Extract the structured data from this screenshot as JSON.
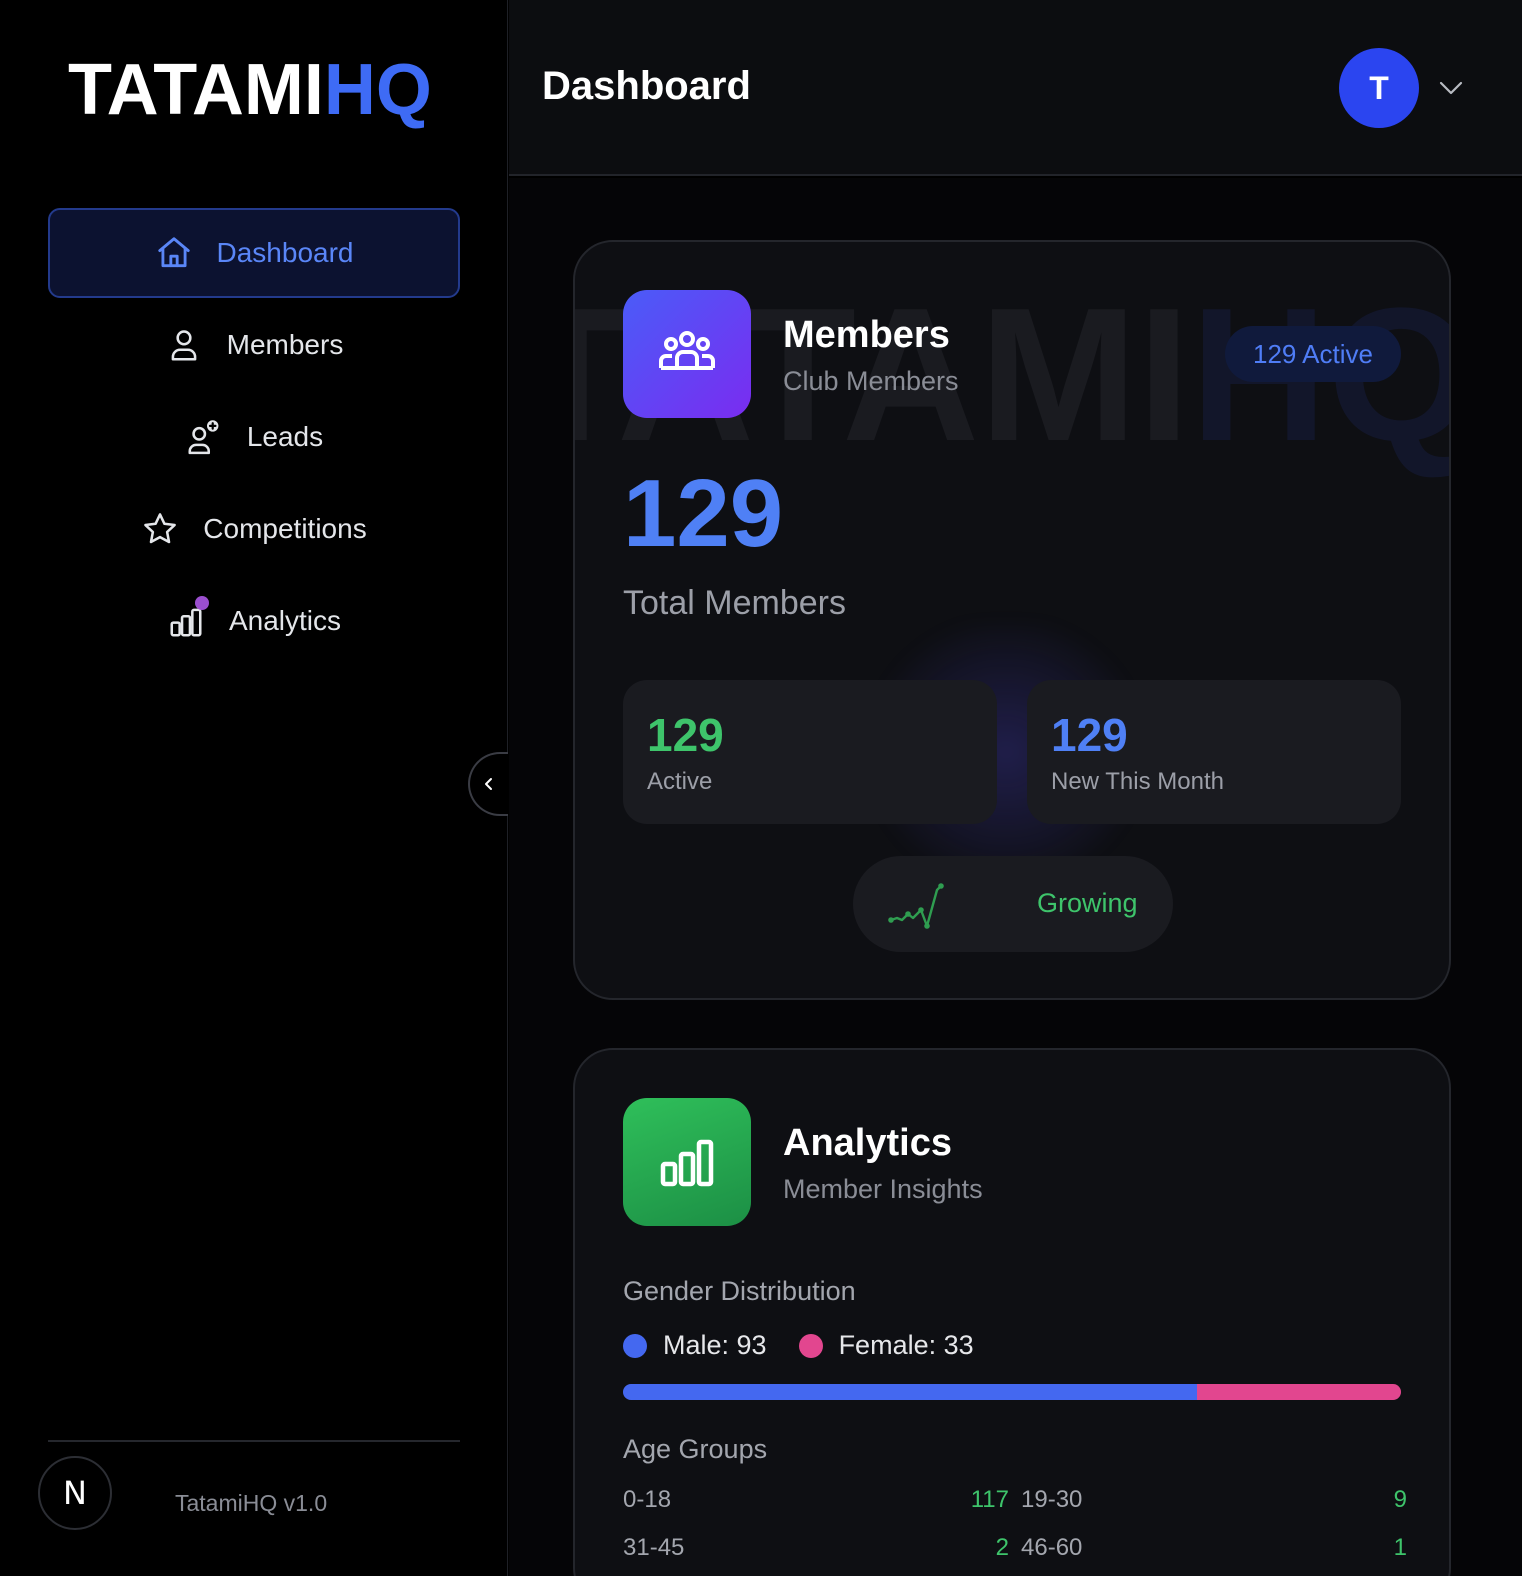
{
  "brand": {
    "part1": "TATAMI",
    "part2": "HQ",
    "accent": "#3e6bf5"
  },
  "sidebar": {
    "items": [
      {
        "label": "Dashboard",
        "icon": "home-icon",
        "active": true
      },
      {
        "label": "Members",
        "icon": "user-icon",
        "active": false
      },
      {
        "label": "Leads",
        "icon": "user-plus-icon",
        "active": false
      },
      {
        "label": "Competitions",
        "icon": "star-icon",
        "active": false
      },
      {
        "label": "Analytics",
        "icon": "bar-chart-icon",
        "active": false,
        "badge": true
      }
    ],
    "collapse_icon": "chevron-left-icon",
    "footer": {
      "avatar_letter": "N",
      "version": "TatamiHQ v1.0"
    }
  },
  "header": {
    "title": "Dashboard",
    "user_initial": "T",
    "menu_icon": "chevron-down-icon"
  },
  "members_card": {
    "watermark_1": "TATAMI",
    "watermark_2": "HQ",
    "icon": "users-group-icon",
    "title": "Members",
    "subtitle": "Club Members",
    "badge": "129 Active",
    "total": "129",
    "total_label": "Total Members",
    "stats": [
      {
        "value": "129",
        "label": "Active",
        "color": "#3ec46b"
      },
      {
        "value": "129",
        "label": "New This Month",
        "color": "#4f80f5"
      }
    ],
    "trend_icon": "trend-up-icon",
    "trend_label": "Growing"
  },
  "analytics_card": {
    "icon": "bar-chart-icon",
    "title": "Analytics",
    "subtitle": "Member Insights",
    "gender_title": "Gender Distribution",
    "gender": {
      "male_label": "Male: 93",
      "female_label": "Female: 33",
      "male": 93,
      "female": 33,
      "male_color": "#4468f0",
      "female_color": "#e2468f"
    },
    "age_title": "Age Groups",
    "age_groups": [
      {
        "label": "0-18",
        "value": "117"
      },
      {
        "label": "19-30",
        "value": "9"
      },
      {
        "label": "31-45",
        "value": "2"
      },
      {
        "label": "46-60",
        "value": "1"
      }
    ]
  }
}
